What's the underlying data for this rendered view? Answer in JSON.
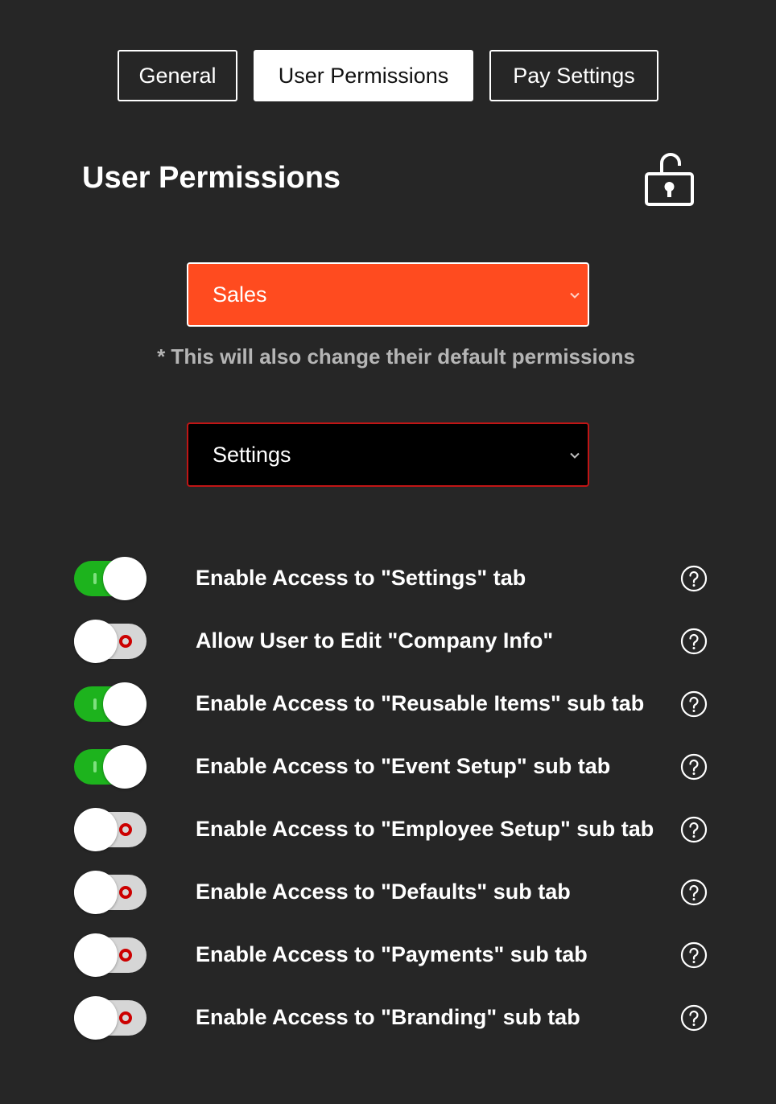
{
  "tabs": [
    {
      "label": "General",
      "active": false
    },
    {
      "label": "User Permissions",
      "active": true
    },
    {
      "label": "Pay Settings",
      "active": false
    }
  ],
  "page_title": "User Permissions",
  "lock_icon": "unlocked-padlock-icon",
  "role_select": {
    "value": "Sales",
    "color": "#ff4b1f"
  },
  "note": "* This will also change their default permissions",
  "section_select": {
    "value": "Settings",
    "border_color": "#c01515"
  },
  "permissions": [
    {
      "label": "Enable Access to \"Settings\" tab",
      "enabled": true
    },
    {
      "label": "Allow User to Edit \"Company Info\"",
      "enabled": false
    },
    {
      "label": "Enable Access to \"Reusable Items\" sub tab",
      "enabled": true
    },
    {
      "label": "Enable Access to \"Event Setup\" sub tab",
      "enabled": true
    },
    {
      "label": "Enable Access to \"Employee Setup\" sub tab",
      "enabled": false
    },
    {
      "label": "Enable Access to \"Defaults\" sub tab",
      "enabled": false
    },
    {
      "label": "Enable Access to \"Payments\" sub tab",
      "enabled": false
    },
    {
      "label": "Enable Access to \"Branding\" sub tab",
      "enabled": false
    }
  ],
  "colors": {
    "toggle_on": "#1db31d",
    "toggle_off": "#d6d6d6",
    "off_indicator": "#cc0000",
    "background": "#262626"
  }
}
